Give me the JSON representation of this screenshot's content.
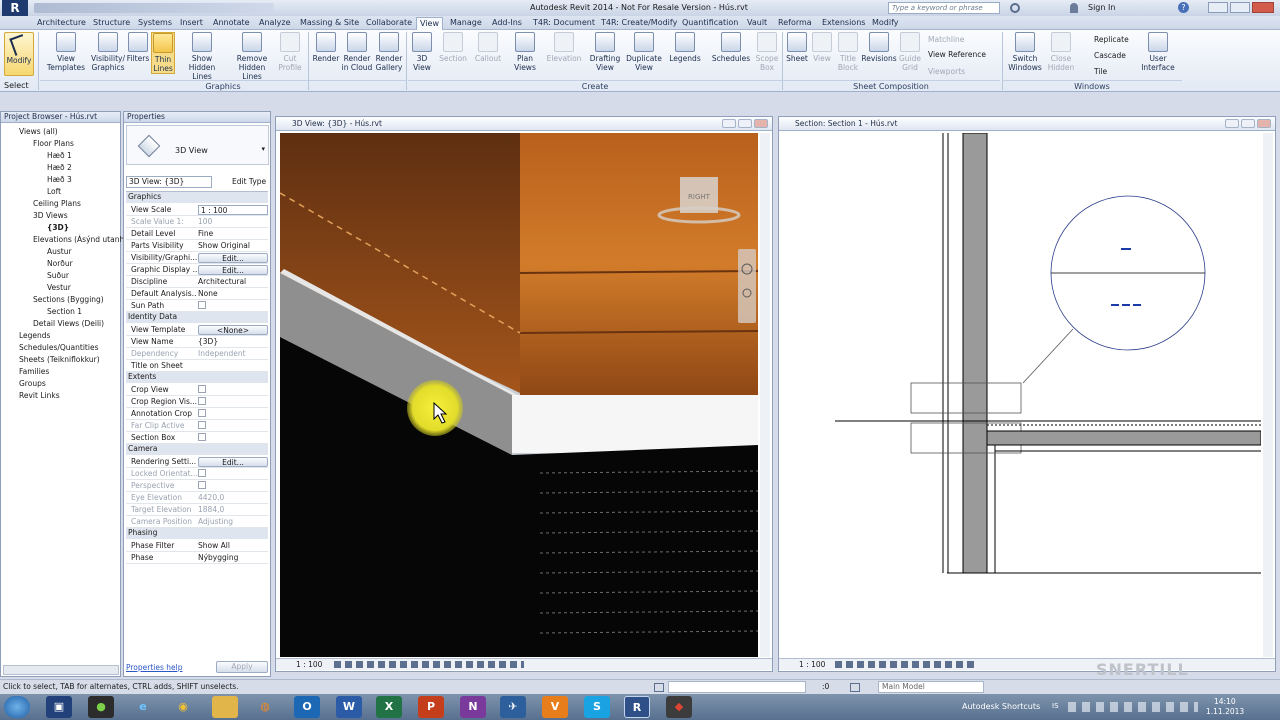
{
  "title_bar": {
    "title": "Autodesk Revit 2014 - Not For Resale Version -",
    "file": "Hús.rvt",
    "search_placeholder": "Type a keyword or phrase",
    "sign_in": "Sign In"
  },
  "ribbon_tabs": [
    "Architecture",
    "Structure",
    "Systems",
    "Insert",
    "Annotate",
    "Analyze",
    "Massing & Site",
    "Collaborate",
    "View",
    "Manage",
    "Add-Ins",
    "T4R: Document",
    "T4R: Create/Modify",
    "Quantification",
    "Vault",
    "Reforma",
    "Extensions",
    "Modify"
  ],
  "active_tab": "View",
  "ribbon": {
    "modify": "Modify",
    "select": "Select",
    "graphics_group": "Graphics",
    "create_group": "Create",
    "sheet_group": "Sheet Composition",
    "windows_group": "Windows",
    "graphics_buttons": [
      "View Templates",
      "Visibility/ Graphics",
      "Filters",
      "Thin Lines",
      "Show Hidden Lines",
      "Remove Hidden Lines",
      "Cut Profile"
    ],
    "create_buttons": [
      "Render",
      "Render in Cloud",
      "Render Gallery",
      "3D View",
      "Section",
      "Callout",
      "Plan Views",
      "Elevation",
      "Drafting View",
      "Duplicate View",
      "Legends",
      "Schedules",
      "Scope Box"
    ],
    "sheet_buttons": [
      "Sheet",
      "View",
      "Title Block",
      "Revisions",
      "Guide Grid"
    ],
    "sheet_small": [
      "Matchline",
      "View Reference",
      "Viewports"
    ],
    "windows_buttons": [
      "Switch Windows",
      "Close Hidden",
      "User Interface"
    ],
    "windows_small": [
      "Replicate",
      "Cascade",
      "Tile"
    ]
  },
  "project_browser": {
    "title": "Project Browser - Hús.rvt",
    "items": [
      "Views (all)",
      "Floor Plans",
      "Hæð 1",
      "Hæð 2",
      "Hæð 3",
      "Loft",
      "Ceiling Plans",
      "3D Views",
      "{3D}",
      "Elevations (Ásýnd utanhú",
      "Austur",
      "Norður",
      "Suður",
      "Vestur",
      "Sections (Bygging)",
      "Section 1",
      "Detail Views (Deili)",
      "Legends",
      "Schedules/Quantities",
      "Sheets (Teikniflokkur)",
      "Families",
      "Groups",
      "Revit Links"
    ]
  },
  "properties": {
    "title": "Properties",
    "type_name": "3D View",
    "selector": "3D View: {3D}",
    "edit_type": "Edit Type",
    "rows": [
      {
        "cat": "Graphics"
      },
      {
        "k": "View Scale",
        "v": "1 : 100",
        "box": true
      },
      {
        "k": "Scale Value    1:",
        "v": "100",
        "grey": true
      },
      {
        "k": "Detail Level",
        "v": "Fine"
      },
      {
        "k": "Parts Visibility",
        "v": "Show Original"
      },
      {
        "k": "Visibility/Graphi...",
        "v": "Edit...",
        "btn": true
      },
      {
        "k": "Graphic Display ...",
        "v": "Edit...",
        "btn": true
      },
      {
        "k": "Discipline",
        "v": "Architectural"
      },
      {
        "k": "Default Analysis...",
        "v": "None"
      },
      {
        "k": "Sun Path",
        "v": "",
        "chk": true
      },
      {
        "cat": "Identity Data"
      },
      {
        "k": "View Template",
        "v": "<None>",
        "btn": true
      },
      {
        "k": "View Name",
        "v": "{3D}"
      },
      {
        "k": "Dependency",
        "v": "Independent",
        "grey": true
      },
      {
        "k": "Title on Sheet",
        "v": ""
      },
      {
        "cat": "Extents"
      },
      {
        "k": "Crop View",
        "v": "",
        "chk": true
      },
      {
        "k": "Crop Region Vis...",
        "v": "",
        "chk": true
      },
      {
        "k": "Annotation Crop",
        "v": "",
        "chk": true
      },
      {
        "k": "Far Clip Active",
        "v": "",
        "chk": true,
        "grey": true
      },
      {
        "k": "Section Box",
        "v": "",
        "chk": true
      },
      {
        "cat": "Camera"
      },
      {
        "k": "Rendering Setti...",
        "v": "Edit...",
        "btn": true
      },
      {
        "k": "Locked Orientat...",
        "v": "",
        "chk": true,
        "grey": true
      },
      {
        "k": "Perspective",
        "v": "",
        "chk": true,
        "grey": true
      },
      {
        "k": "Eye Elevation",
        "v": "4420,0",
        "grey": true
      },
      {
        "k": "Target Elevation",
        "v": "1884,0",
        "grey": true
      },
      {
        "k": "Camera Position",
        "v": "Adjusting",
        "grey": true
      },
      {
        "cat": "Phasing"
      },
      {
        "k": "Phase Filter",
        "v": "Show All"
      },
      {
        "k": "Phase",
        "v": "Nýbygging"
      }
    ],
    "help": "Properties help",
    "apply": "Apply"
  },
  "view3d": {
    "title": "3D View: {3D} - Hús.rvt",
    "scale": "1 : 100",
    "cube_label": "RIGHT"
  },
  "section": {
    "title": "Section: Section 1 - Hús.rvt",
    "scale": "1 : 100"
  },
  "status": {
    "text": "Click to select, TAB for alternates, CTRL adds, SHIFT unselects.",
    "zero": ":0",
    "model": "Main Model"
  },
  "taskbar": {
    "shortcuts": "Autodesk Shortcuts",
    "lang": "IS",
    "time": "14:10",
    "date": "1.11.2013"
  },
  "watermark": "SNERTILL",
  "colors": {
    "ribbon_bg": "#e2e9f4",
    "wood": "#c46a1e",
    "highlight": "#f1ec3c",
    "taskbar": "#6a819e"
  }
}
